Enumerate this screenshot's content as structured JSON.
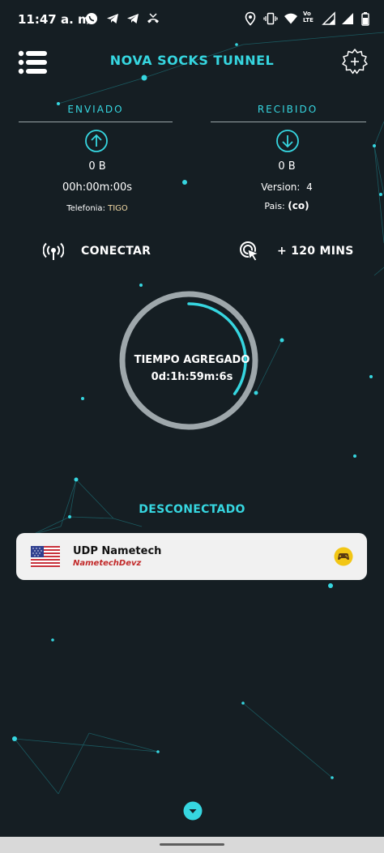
{
  "status_bar": {
    "time": "11:47 a. m.",
    "volte": "Vo\nLTE",
    "icons": [
      "whatsapp-icon",
      "telegram-icon",
      "telegram-icon",
      "missed-call-icon",
      "location-icon",
      "vibrate-icon",
      "wifi-icon",
      "volte-icon",
      "signal-icon",
      "battery-icon"
    ]
  },
  "header": {
    "title": "NOVA SOCKS TUNNEL"
  },
  "sent": {
    "heading": "ENVIADO",
    "amount": "0 B",
    "duration": "00h:00m:00s",
    "carrier_label": "Telefonia:",
    "carrier_value": "TIGO"
  },
  "received": {
    "heading": "RECIBIDO",
    "amount": "0 B",
    "version_label": "Version:",
    "version_value": "4",
    "country_label": "Pais:",
    "country_value": "(co)"
  },
  "actions": {
    "connect_label": "CONECTAR",
    "add_time_label": "+ 120 MINS"
  },
  "timer": {
    "title": "TIEMPO AGREGADO",
    "value": "0d:1h:59m:6s",
    "progress_fraction": 0.35
  },
  "connection_status": "DESCONECTADO",
  "server": {
    "name": "UDP Nametech",
    "provider": "NametechDevz",
    "flag": "us-flag-icon"
  },
  "colors": {
    "accent": "#36d6e0",
    "background": "#151e23",
    "card": "#f1f1f1",
    "provider_text": "#c22a2a"
  }
}
